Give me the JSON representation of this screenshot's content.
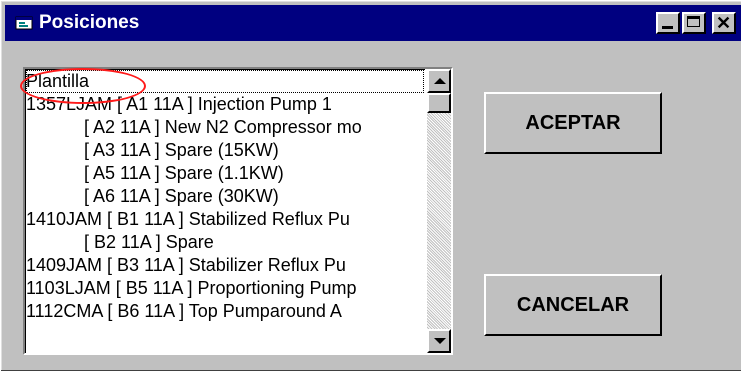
{
  "window": {
    "title": "Posiciones",
    "controls": {
      "minimize": "minimize-icon",
      "maximize": "maximize-icon",
      "close": "✕"
    }
  },
  "list": {
    "items": [
      "Plantilla",
      "1357LJAM  [ A1 11A ] Injection Pump 1",
      "[ A2 11A ] New N2 Compressor mo",
      "[ A3 11A ] Spare (15KW)",
      "[ A5 11A ] Spare (1.1KW)",
      "[ A6 11A ] Spare (30KW)",
      "1410JAM  [ B1 11A ] Stabilized Reflux Pu",
      "[ B2 11A ] Spare",
      "1409JAM  [ B3 11A ] Stabilizer Reflux Pu",
      "1103LJAM [ B5 11A ] Proportioning Pump",
      "1112CMA  [ B6 11A ] Top Pumparound A"
    ],
    "selected_index": 0
  },
  "buttons": {
    "accept": "ACEPTAR",
    "cancel": "CANCELAR"
  },
  "colors": {
    "titlebar": "#000080",
    "face": "#c0c0c0",
    "annotation": "#ff1a1a"
  }
}
